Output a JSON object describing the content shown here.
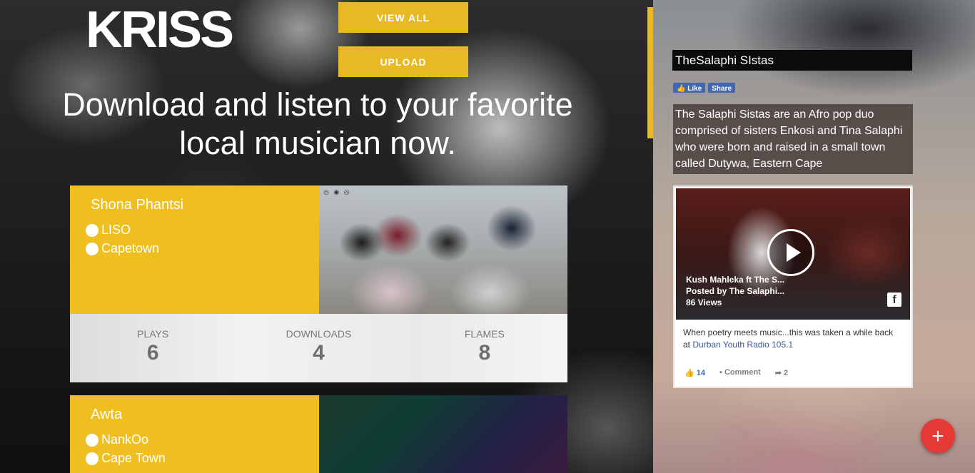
{
  "brand": {
    "logo": "KRISS"
  },
  "header": {
    "view_all_label": "VIEW ALL",
    "upload_label": "UPLOAD",
    "headline": "Download and listen to your favorite local musician now."
  },
  "songs": [
    {
      "title": "Shona Phantsi",
      "artist": "LISO",
      "location": "Capetown",
      "stats": {
        "plays_label": "PLAYS",
        "plays": "6",
        "downloads_label": "DOWNLOADS",
        "downloads": "4",
        "flames_label": "FLAMES",
        "flames": "8"
      }
    },
    {
      "title": "Awta",
      "artist": "NankOo",
      "location": "Cape Town"
    }
  ],
  "artist_panel": {
    "name": "TheSalaphi SIstas",
    "fb_like": "Like",
    "fb_share": "Share",
    "bio": "The Salaphi Sistas are an Afro pop duo comprised of sisters Enkosi and Tina Salaphi who were born and raised in a small town called Dutywa, Eastern Cape",
    "video": {
      "title": "Kush Mahleka ft The S...",
      "posted_by": "Posted by The Salaphi...",
      "views": "86 Views",
      "caption_prefix": "When poetry meets music...this was taken a while back at",
      "caption_link": "Durban Youth Radio 105.1",
      "likes": "14",
      "comment_label": "Comment",
      "shares": "2"
    }
  },
  "fab": {
    "label": "+"
  },
  "colors": {
    "accent": "#e8b923",
    "fab": "#e53935",
    "facebook": "#4267b2"
  }
}
